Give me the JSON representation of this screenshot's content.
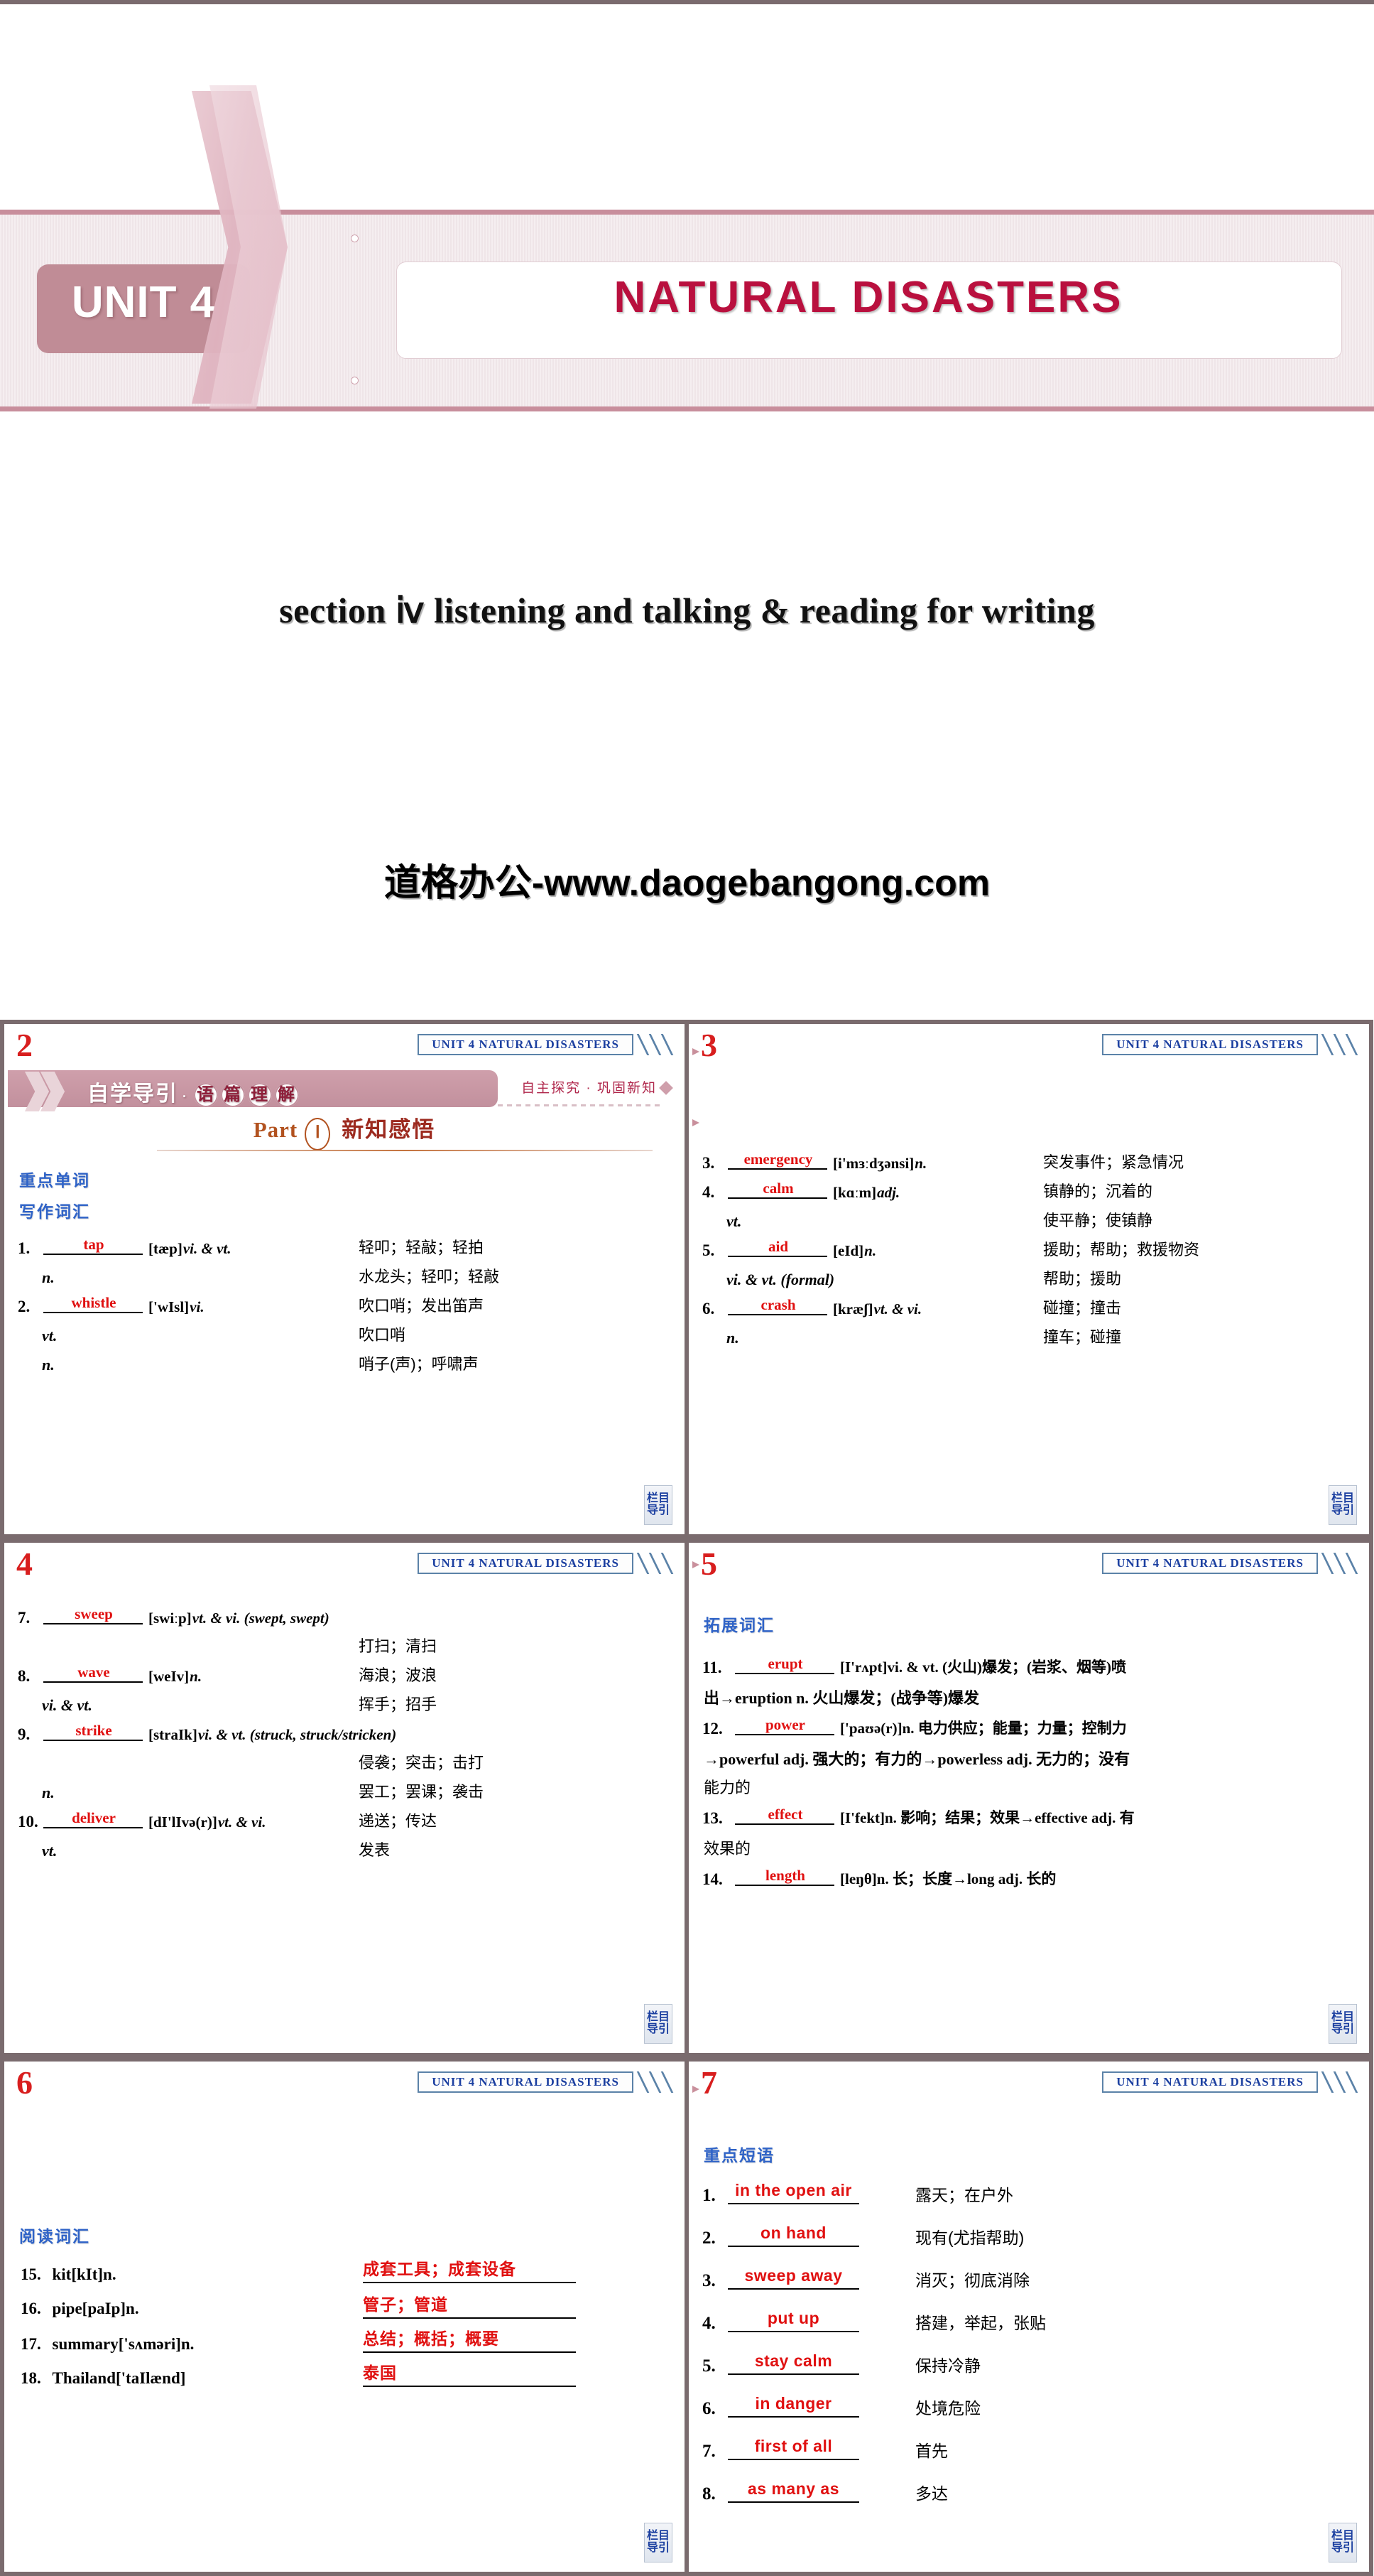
{
  "title_slide": {
    "unit_label": "UNIT 4",
    "main_title": "NATURAL DISASTERS",
    "subtitle": "section ⅳ listening and talking & reading for writing",
    "watermark": "道格办公-www.daogebangong.com",
    "colors": {
      "accent_red": "#b9103e",
      "band_pink": "#c88e9c",
      "unit_box": "#c08c96"
    }
  },
  "common": {
    "unit_banner": "UNIT 4   NATURAL  DISASTERS",
    "nav_button_line1": "栏目",
    "nav_button_line2": "导引",
    "banner_blue": "#1b3fa0"
  },
  "slides": [
    {
      "number": "2",
      "guide_banner": {
        "text1": "自学导引",
        "dot": "·",
        "c1": "语",
        "c2": "篇",
        "c3": "理",
        "c4": "解"
      },
      "guide_right": "自主探究 · 巩固新知",
      "part": {
        "label": "Part",
        "roman": "Ⅰ",
        "cn": "新知感悟"
      },
      "heads": [
        "重点单词",
        "写作词汇"
      ],
      "vocab": [
        {
          "num": "1.",
          "answer": "tap",
          "pron": "[tæp]",
          "pos": "vi. & vt.",
          "meaning": "轻叩；轻敲；轻拍"
        },
        {
          "num": "",
          "answer": "",
          "pron": "",
          "pos": "n.",
          "meaning": "水龙头；轻叩；轻敲"
        },
        {
          "num": "2.",
          "answer": "whistle",
          "pron": "['wIsl]",
          "pos": "vi.",
          "meaning": "吹口哨；发出笛声"
        },
        {
          "num": "",
          "answer": "",
          "pron": "",
          "pos": "vt.",
          "meaning": "吹口哨"
        },
        {
          "num": "",
          "answer": "",
          "pron": "",
          "pos": "n.",
          "meaning": "哨子(声)；呼啸声"
        }
      ]
    },
    {
      "number": "3",
      "vocab": [
        {
          "num": "3.",
          "answer": "emergency",
          "pron": "[i'mɜːdʒənsi]",
          "pos": "n.",
          "meaning": "突发事件；紧急情况"
        },
        {
          "num": "4.",
          "answer": "calm",
          "pron": "[kɑːm]",
          "pos": "adj.",
          "meaning": "镇静的；沉着的"
        },
        {
          "num": "",
          "answer": "",
          "pron": "",
          "pos": "vt.",
          "meaning": "使平静；使镇静"
        },
        {
          "num": "5.",
          "answer": "aid",
          "pron": "[eId]",
          "pos": "n.",
          "meaning": "援助；帮助；救援物资"
        },
        {
          "num": "",
          "answer": "",
          "pron": "",
          "pos": "vi. & vt. (formal)",
          "meaning": "帮助；援助"
        },
        {
          "num": "6.",
          "answer": "crash",
          "pron": "[kræʃ]",
          "pos": "vt. & vi.",
          "meaning": "碰撞；撞击"
        },
        {
          "num": "",
          "answer": "",
          "pron": "",
          "pos": "n.",
          "meaning": "撞车；碰撞"
        }
      ]
    },
    {
      "number": "4",
      "vocab": [
        {
          "num": "7.",
          "answer": "sweep",
          "pron": "[swiːp]",
          "pos": "vt. & vi.  (swept, swept)",
          "meaning": ""
        },
        {
          "num": "",
          "answer": "",
          "pron": "",
          "pos": "",
          "meaning": "打扫；清扫"
        },
        {
          "num": "8.",
          "answer": "wave",
          "pron": "[weIv]",
          "pos": "n.",
          "meaning": "海浪；波浪"
        },
        {
          "num": "",
          "answer": "",
          "pron": "",
          "pos": "vi. & vt.",
          "meaning": "挥手；招手"
        },
        {
          "num": "9.",
          "answer": "strike",
          "pron": "[straIk]",
          "pos": "vi. & vt.  (struck, struck/stricken)",
          "meaning": ""
        },
        {
          "num": "",
          "answer": "",
          "pron": "",
          "pos": "",
          "meaning": "侵袭；突击；击打"
        },
        {
          "num": "",
          "answer": "",
          "pron": "",
          "pos": "n.",
          "meaning": "罢工；罢课；袭击"
        },
        {
          "num": "10.",
          "answer": "deliver",
          "pron": "[dI'lIvə(r)]",
          "pos": "vt. & vi.",
          "meaning": "递送；传达"
        },
        {
          "num": "",
          "answer": "",
          "pron": "",
          "pos": "vt.",
          "meaning": "发表"
        }
      ]
    },
    {
      "number": "5",
      "heads": [
        "拓展词汇"
      ],
      "entries": [
        {
          "num": "11.",
          "answer": "erupt",
          "rest1": "[I'rʌpt]vi. & vt. (火山)爆发；(岩浆、烟等)喷",
          "rest2": "出→eruption n. 火山爆发；(战争等)爆发"
        },
        {
          "num": "12.",
          "answer": "power",
          "rest1": "['paʊə(r)]n. 电力供应；能量；力量；控制力",
          "rest2": "→powerful adj. 强大的；有力的→powerless adj. 无力的；没有",
          "rest3": "能力的"
        },
        {
          "num": "13.",
          "answer": "effect",
          "rest1": "[I'fekt]n. 影响；结果；效果→effective adj. 有",
          "rest2": "效果的"
        },
        {
          "num": "14.",
          "answer": "length",
          "rest1": "[leŋθ]n. 长；长度→long adj. 长的",
          "rest2": ""
        }
      ]
    },
    {
      "number": "6",
      "heads": [
        "阅读词汇"
      ],
      "reading": [
        {
          "num": "15.",
          "word": "kit[kIt]n.",
          "answer": "成套工具；成套设备"
        },
        {
          "num": "16.",
          "word": "pipe[paIp]n.",
          "answer": "管子；管道"
        },
        {
          "num": "17.",
          "word": "summary['sʌməri]n.",
          "answer": "总结；概括；概要"
        },
        {
          "num": "18.",
          "word": "Thailand['taIlænd]",
          "answer": "泰国"
        }
      ]
    },
    {
      "number": "7",
      "heads": [
        "重点短语"
      ],
      "phrases": [
        {
          "num": "1.",
          "answer": "in the open air",
          "meaning": "露天；在户外"
        },
        {
          "num": "2.",
          "answer": "on hand",
          "meaning": "现有(尤指帮助)"
        },
        {
          "num": "3.",
          "answer": "sweep away",
          "meaning": "消灭；彻底消除"
        },
        {
          "num": "4.",
          "answer": "put up",
          "meaning": "搭建，举起，张贴"
        },
        {
          "num": "5.",
          "answer": "stay calm",
          "meaning": "保持冷静"
        },
        {
          "num": "6.",
          "answer": "in danger",
          "meaning": "处境危险"
        },
        {
          "num": "7.",
          "answer": "first of all",
          "meaning": "首先"
        },
        {
          "num": "8.",
          "answer": "as many as",
          "meaning": "多达"
        }
      ]
    }
  ]
}
